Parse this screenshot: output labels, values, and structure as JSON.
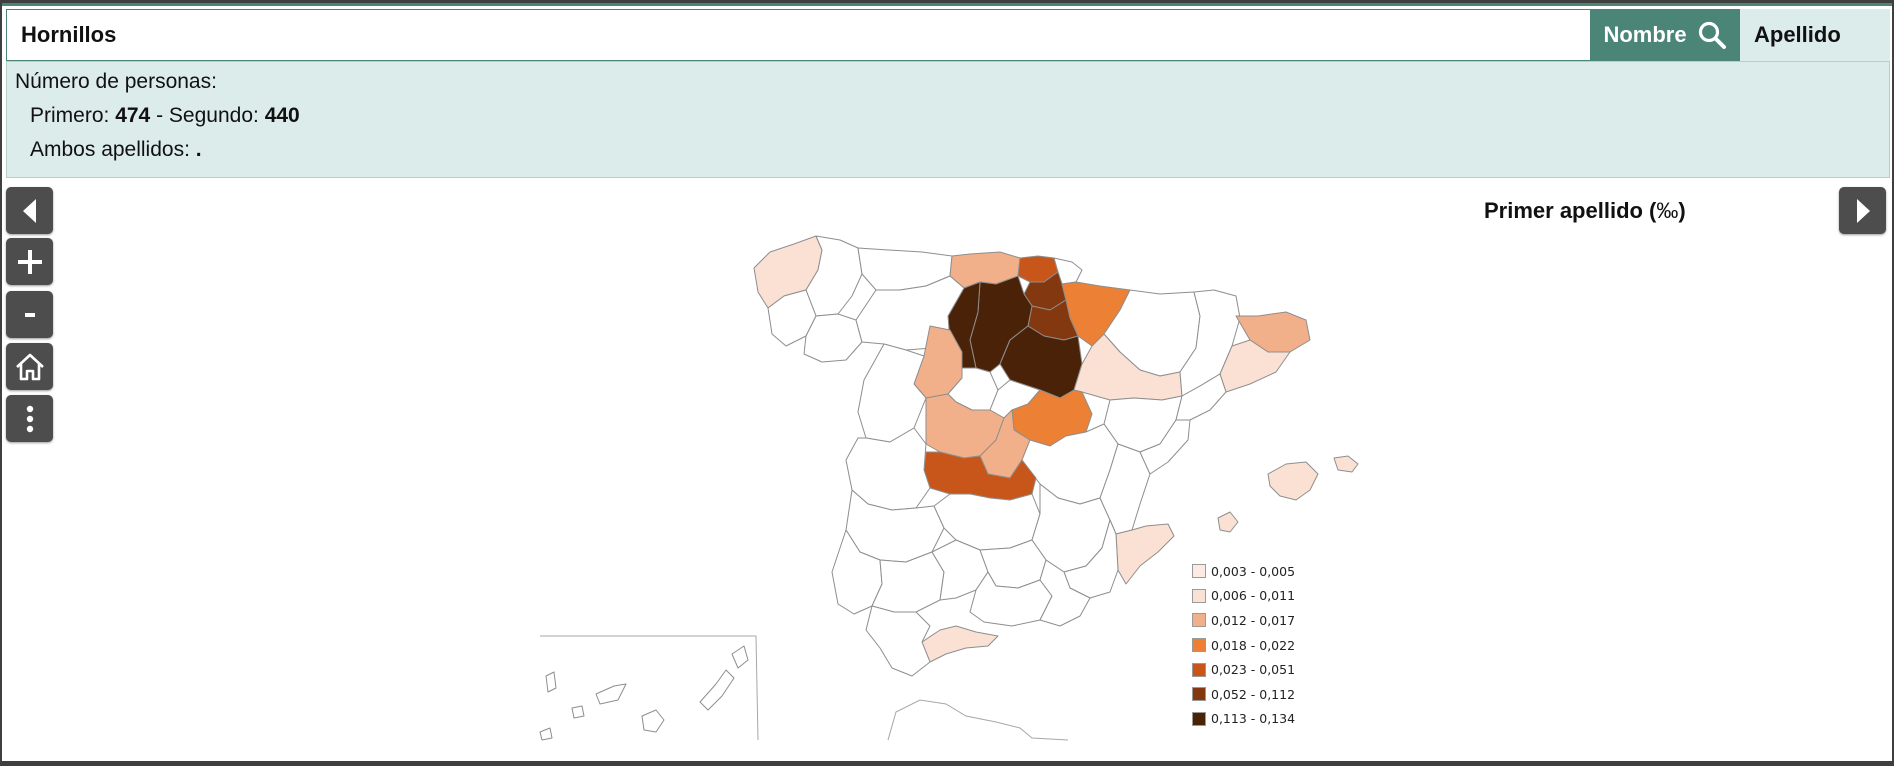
{
  "search": {
    "value": "Hornillos"
  },
  "buttons": {
    "nombre": "Nombre",
    "apellido": "Apellido"
  },
  "info": {
    "heading": "Número de personas:",
    "primero_label": "Primero:",
    "primero_value": "474",
    "sep": "- Segundo:",
    "segundo_value": "440",
    "ambos_label": "Ambos apellidos:",
    "ambos_value": "."
  },
  "map": {
    "title": "Primer apellido (",
    "title_unit": "‰",
    "title_close": ")",
    "legend": [
      {
        "label": "0,003 - 0,005",
        "color": "#fbebe2"
      },
      {
        "label": "0,006 - 0,011",
        "color": "#fbe1d3"
      },
      {
        "label": "0,012 - 0,017",
        "color": "#f2b08a"
      },
      {
        "label": "0,018 - 0,022",
        "color": "#ec8136"
      },
      {
        "label": "0,023 - 0,051",
        "color": "#c8561a"
      },
      {
        "label": "0,052 - 0,112",
        "color": "#83380f"
      },
      {
        "label": "0,113 - 0,134",
        "color": "#4a2208"
      }
    ]
  },
  "controls": [
    "back-arrow-icon",
    "zoom-in-icon",
    "zoom-out-icon",
    "home-icon",
    "more-vertical-icon",
    "forward-arrow-icon"
  ]
}
